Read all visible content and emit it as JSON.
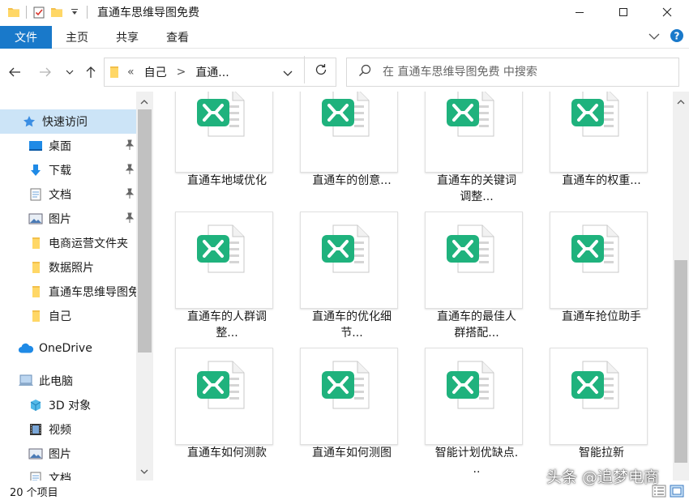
{
  "window": {
    "title": "直通车思维导图免费"
  },
  "ribbon": {
    "tabs": [
      "文件",
      "主页",
      "共享",
      "查看"
    ]
  },
  "address": {
    "crumbs": [
      "«",
      "自己",
      ">",
      "直通..."
    ]
  },
  "search": {
    "placeholder": "在 直通车思维导图免费 中搜索"
  },
  "nav": {
    "items": [
      {
        "label": "快速访问",
        "icon": "star-icon"
      },
      {
        "label": "桌面",
        "icon": "desktop-icon"
      },
      {
        "label": "下载",
        "icon": "download-icon"
      },
      {
        "label": "文档",
        "icon": "document-icon"
      },
      {
        "label": "图片",
        "icon": "picture-icon"
      },
      {
        "label": "电商运营文件夹",
        "icon": "folder-icon"
      },
      {
        "label": "数据照片",
        "icon": "folder-icon"
      },
      {
        "label": "直通车思维导图免费",
        "icon": "folder-icon"
      },
      {
        "label": "自己",
        "icon": "folder-icon"
      },
      {
        "label": "OneDrive",
        "icon": "cloud-icon"
      },
      {
        "label": "此电脑",
        "icon": "computer-icon"
      },
      {
        "label": "3D 对象",
        "icon": "cube-icon"
      },
      {
        "label": "视频",
        "icon": "video-icon"
      },
      {
        "label": "图片",
        "icon": "picture-icon"
      },
      {
        "label": "文档",
        "icon": "document-icon"
      }
    ]
  },
  "files": [
    {
      "line1": "直通车地域优化",
      "line2": ""
    },
    {
      "line1": "直通车的创意...",
      "line2": ""
    },
    {
      "line1": "直通车的关键词",
      "line2": "调整..."
    },
    {
      "line1": "直通车的权重...",
      "line2": ""
    },
    {
      "line1": "直通车的人群调",
      "line2": "整..."
    },
    {
      "line1": "直通车的优化细",
      "line2": "节..."
    },
    {
      "line1": "直通车的最佳人",
      "line2": "群搭配..."
    },
    {
      "line1": "直通车抢位助手",
      "line2": ""
    },
    {
      "line1": "直通车如何测款",
      "line2": ""
    },
    {
      "line1": "直通车如何测图",
      "line2": ""
    },
    {
      "line1": "智能计划优缺点.",
      "line2": ".."
    },
    {
      "line1": "智能拉新",
      "line2": ""
    }
  ],
  "status": {
    "count": "20 个项目"
  },
  "watermark": {
    "text": "头条 @追梦电商"
  },
  "colors": {
    "accent": "#1979ca",
    "xmind_green": "#1fb27d",
    "selection": "#cce4f7",
    "folder": "#f3c04b"
  }
}
